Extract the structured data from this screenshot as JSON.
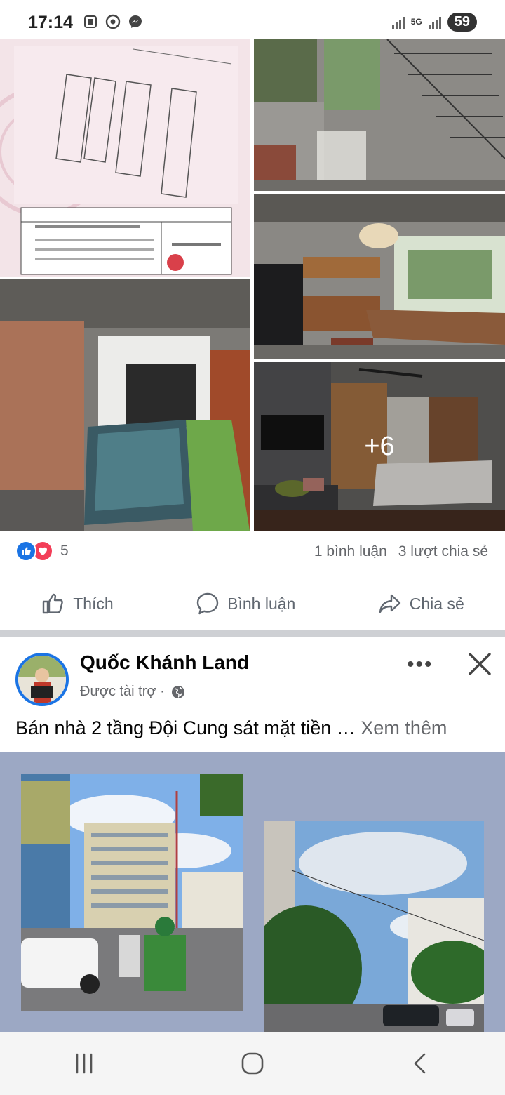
{
  "status_bar": {
    "time": "17:14",
    "network": "5G",
    "battery": "59",
    "icons": [
      "screenshot-icon",
      "chrome-icon",
      "messenger-icon",
      "signal-icon",
      "signal-icon"
    ]
  },
  "post1": {
    "more_photos": "+6",
    "reaction_count": "5",
    "comments": "1 bình luận",
    "shares": "3 lượt chia sẻ",
    "actions": {
      "like": "Thích",
      "comment": "Bình luận",
      "share": "Chia sẻ"
    }
  },
  "post2": {
    "page_name": "Quốc Khánh Land",
    "sponsored": "Được tài trợ ·",
    "text": "Bán nhà 2 tầng Đội Cung sát mặt tiền … ",
    "see_more": "Xem thêm"
  },
  "colors": {
    "facebook_blue": "#1b74e4",
    "love_red": "#f33e58",
    "secondary_text": "#65676b",
    "ad_background": "#9ca8c4"
  }
}
